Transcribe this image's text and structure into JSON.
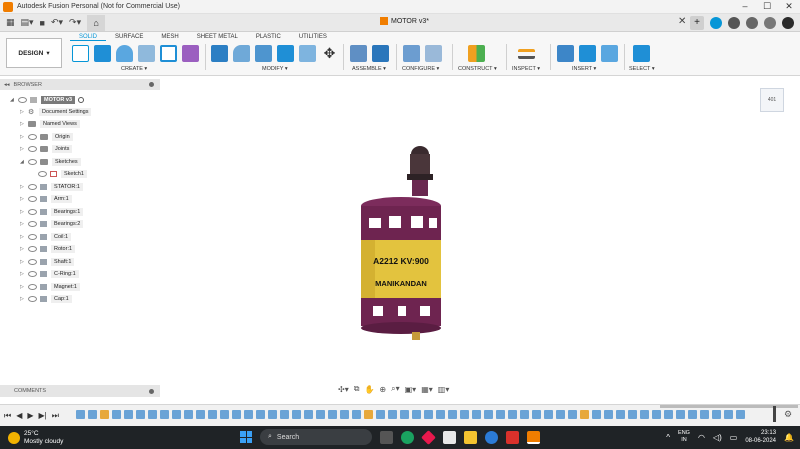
{
  "window": {
    "title": "Autodesk Fusion Personal (Not for Commercial Use)",
    "min": "–",
    "max": "☐",
    "close": "✕"
  },
  "document_tab": {
    "name": "MOTOR v3*",
    "close": "✕"
  },
  "workspace": {
    "label": "DESIGN",
    "tabs": [
      "SOLID",
      "SURFACE",
      "MESH",
      "SHEET METAL",
      "PLASTIC",
      "UTILITIES"
    ],
    "active_tab": "SOLID"
  },
  "groups": [
    "CREATE ▾",
    "MODIFY ▾",
    "ASSEMBLE ▾",
    "CONFIGURE ▾",
    "CONSTRUCT ▾",
    "INSPECT ▾",
    "INSERT ▾",
    "SELECT ▾"
  ],
  "browser": {
    "title": "BROWSER",
    "root": "MOTOR v3",
    "items": [
      {
        "label": "Document Settings",
        "kind": "gear"
      },
      {
        "label": "Named Views",
        "kind": "folder"
      },
      {
        "label": "Origin",
        "kind": "folder"
      },
      {
        "label": "Joints",
        "kind": "folder"
      },
      {
        "label": "Sketches",
        "kind": "folder"
      },
      {
        "label": "Sketch1",
        "kind": "sketch"
      },
      {
        "label": "STATOR:1",
        "kind": "comp"
      },
      {
        "label": "Arm:1",
        "kind": "comp"
      },
      {
        "label": "Bearings:1",
        "kind": "comp"
      },
      {
        "label": "Bearings:2",
        "kind": "comp"
      },
      {
        "label": "Coil:1",
        "kind": "comp"
      },
      {
        "label": "Rotor:1",
        "kind": "comp"
      },
      {
        "label": "Shaft:1",
        "kind": "comp"
      },
      {
        "label": "C-Ring:1",
        "kind": "comp"
      },
      {
        "label": "Magnet:1",
        "kind": "comp"
      },
      {
        "label": "Cap:1",
        "kind": "comp"
      }
    ]
  },
  "comments": {
    "title": "COMMENTS"
  },
  "model": {
    "line1": "A2212  KV:900",
    "line2": "MANIKANDAN"
  },
  "viewcube": {
    "face": "401"
  },
  "taskbar": {
    "weather_temp": "25°C",
    "weather_desc": "Mostly cloudy",
    "search_placeholder": "Search",
    "lang1": "ENG",
    "lang2": "IN",
    "time": "23:13",
    "date": "08-06-2024"
  },
  "colors": {
    "accent": "#0696d7",
    "housing": "#6e2450",
    "label": "#e3c33e"
  }
}
